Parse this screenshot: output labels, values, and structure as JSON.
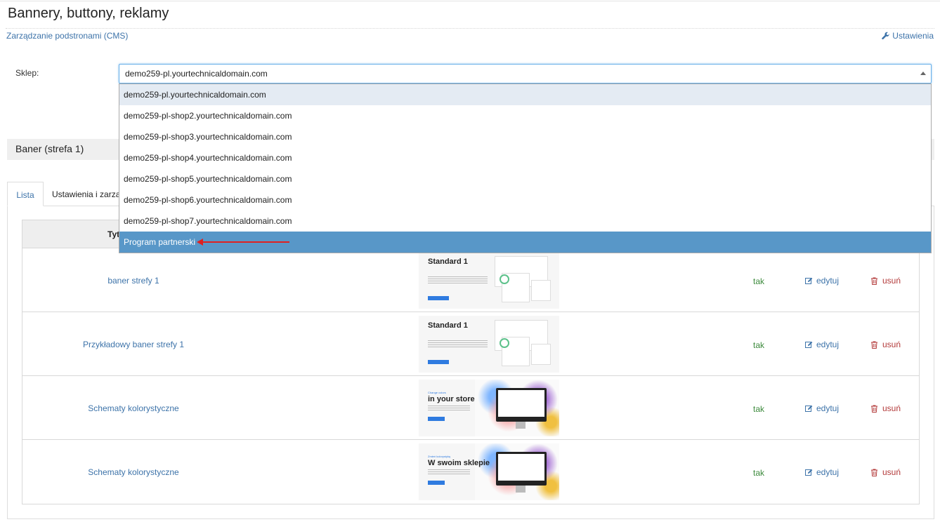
{
  "page": {
    "title": "Bannery, buttony, reklamy",
    "breadcrumb": "Zarządzanie podstronami (CMS)",
    "settings_link": "Ustawienia"
  },
  "shop": {
    "label": "Sklep:",
    "selected": "demo259-pl.yourtechnicaldomain.com",
    "options": [
      "demo259-pl.yourtechnicaldomain.com",
      "demo259-pl-shop2.yourtechnicaldomain.com",
      "demo259-pl-shop3.yourtechnicaldomain.com",
      "demo259-pl-shop4.yourtechnicaldomain.com",
      "demo259-pl-shop5.yourtechnicaldomain.com",
      "demo259-pl-shop6.yourtechnicaldomain.com",
      "demo259-pl-shop7.yourtechnicaldomain.com",
      "Program partnerski"
    ]
  },
  "section": {
    "title": "Baner (strefa 1)"
  },
  "tabs": {
    "list": "Lista",
    "settings": "Ustawienia i zarza"
  },
  "table": {
    "col_title": "Tyt",
    "rows": [
      {
        "name": "baner strefy 1",
        "thumb": {
          "kind": "standard",
          "title": "Standard 1"
        },
        "active": "tak",
        "edit": "edytuj",
        "delete": "usuń"
      },
      {
        "name": "Przykładowy baner strefy 1",
        "thumb": {
          "kind": "standard",
          "title": "Standard 1"
        },
        "active": "tak",
        "edit": "edytuj",
        "delete": "usuń"
      },
      {
        "name": "Schematy kolorystyczne",
        "thumb": {
          "kind": "scheme",
          "small": "Change colors",
          "title": "in your store"
        },
        "active": "tak",
        "edit": "edytuj",
        "delete": "usuń"
      },
      {
        "name": "Schematy kolorystyczne",
        "thumb": {
          "kind": "scheme",
          "small": "Zmień kolorystykę",
          "title": "W swoim sklepie"
        },
        "active": "tak",
        "edit": "edytuj",
        "delete": "usuń"
      }
    ]
  },
  "colors": {
    "link": "#3d73a9",
    "highlight": "#5897c8",
    "active_text": "#3c8a3c",
    "delete_text": "#b33a3a",
    "annotation_arrow": "#e02020"
  }
}
